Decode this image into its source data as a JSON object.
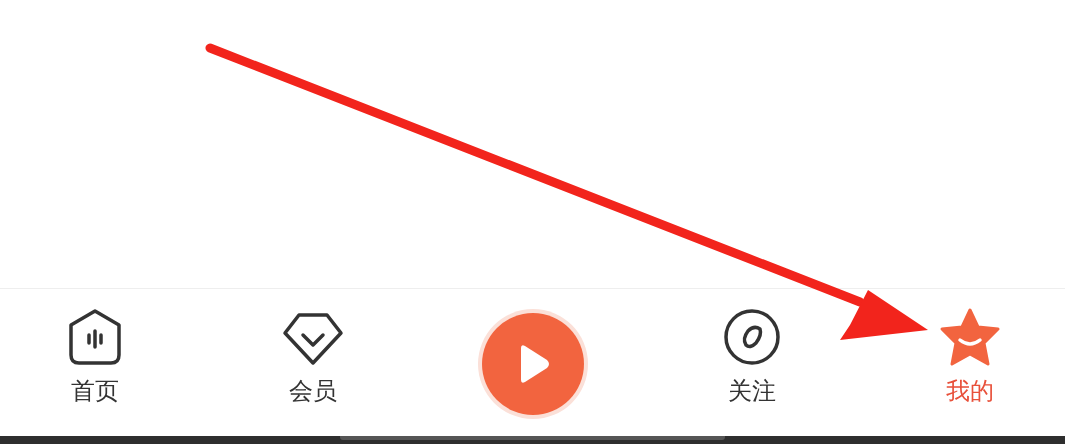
{
  "tab_bar": {
    "items": [
      {
        "kind": "tab",
        "label": "首页",
        "selected": false
      },
      {
        "kind": "tab",
        "label": "会员",
        "selected": false
      },
      {
        "kind": "play"
      },
      {
        "kind": "tab",
        "label": "关注",
        "selected": false
      },
      {
        "kind": "tab",
        "label": "我的",
        "selected": true
      }
    ]
  },
  "annotation": {
    "kind": "arrow"
  }
}
